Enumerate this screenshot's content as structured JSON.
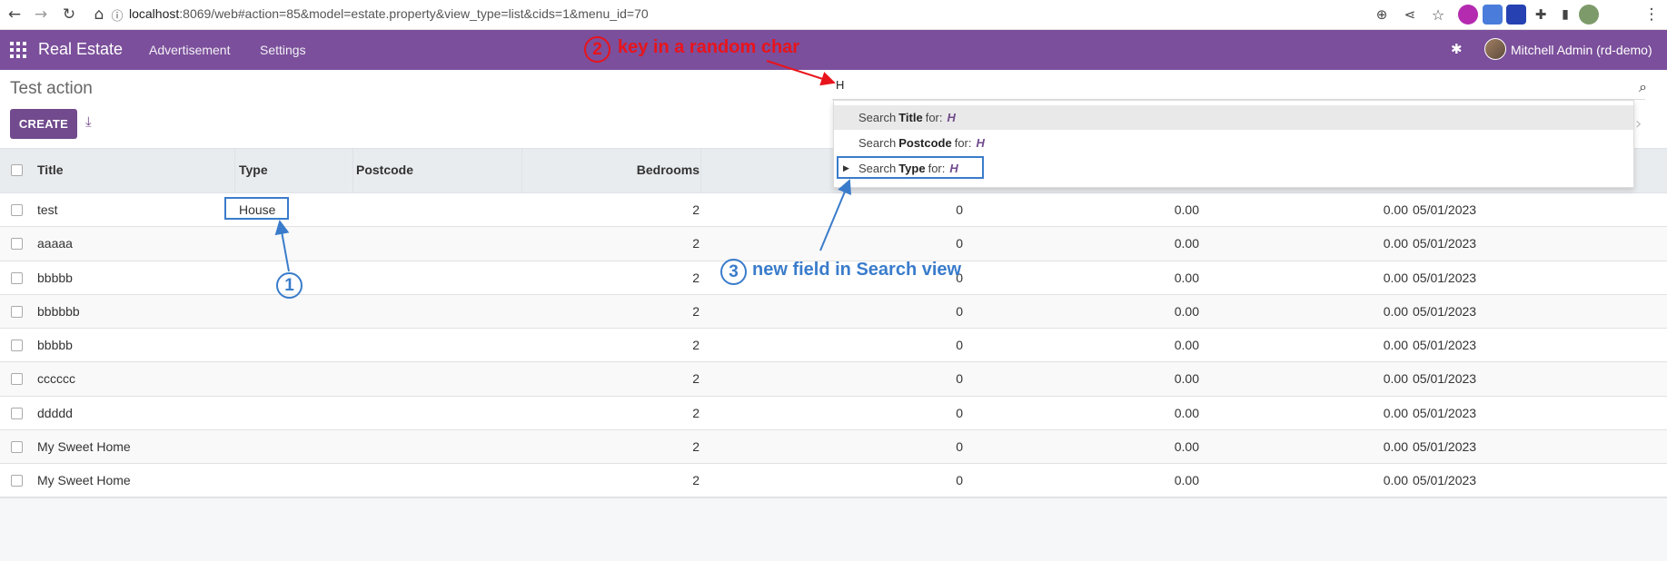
{
  "browser": {
    "url_host": "localhost",
    "url_rest": ":8069/web#action=85&model=estate.property&view_type=list&cids=1&menu_id=70"
  },
  "navbar": {
    "brand": "Real Estate",
    "menu": [
      "Advertisement",
      "Settings"
    ],
    "user": "Mitchell Admin (rd-demo)"
  },
  "control": {
    "title": "Test action",
    "create_label": "CREATE",
    "search_value": "H"
  },
  "table": {
    "columns": [
      "Title",
      "Type",
      "Postcode",
      "Bedrooms"
    ],
    "rows": [
      {
        "title": "test",
        "type": "House",
        "bedrooms": "2",
        "c1": "0",
        "c2": "0.00",
        "c3": "0.00",
        "date": "05/01/2023"
      },
      {
        "title": "aaaaa",
        "type": "",
        "bedrooms": "2",
        "c1": "0",
        "c2": "0.00",
        "c3": "0.00",
        "date": "05/01/2023"
      },
      {
        "title": "bbbbb",
        "type": "",
        "bedrooms": "2",
        "c1": "0",
        "c2": "0.00",
        "c3": "0.00",
        "date": "05/01/2023"
      },
      {
        "title": "bbbbbb",
        "type": "",
        "bedrooms": "2",
        "c1": "0",
        "c2": "0.00",
        "c3": "0.00",
        "date": "05/01/2023"
      },
      {
        "title": "bbbbb",
        "type": "",
        "bedrooms": "2",
        "c1": "0",
        "c2": "0.00",
        "c3": "0.00",
        "date": "05/01/2023"
      },
      {
        "title": "cccccc",
        "type": "",
        "bedrooms": "2",
        "c1": "0",
        "c2": "0.00",
        "c3": "0.00",
        "date": "05/01/2023"
      },
      {
        "title": "ddddd",
        "type": "",
        "bedrooms": "2",
        "c1": "0",
        "c2": "0.00",
        "c3": "0.00",
        "date": "05/01/2023"
      },
      {
        "title": "My Sweet Home",
        "type": "",
        "bedrooms": "2",
        "c1": "0",
        "c2": "0.00",
        "c3": "0.00",
        "date": "05/01/2023"
      },
      {
        "title": "My Sweet Home",
        "type": "",
        "bedrooms": "2",
        "c1": "0",
        "c2": "0.00",
        "c3": "0.00",
        "date": "05/01/2023"
      }
    ]
  },
  "autocomplete": [
    {
      "prefix": "Search",
      "field": "Title",
      "suffix": "for:",
      "value": "H"
    },
    {
      "prefix": "Search",
      "field": "Postcode",
      "suffix": "for:",
      "value": "H"
    },
    {
      "prefix": "Search",
      "field": "Type",
      "suffix": "for:",
      "value": "H"
    }
  ],
  "annotations": {
    "one": "1",
    "two": "2",
    "three": "3",
    "text_two": "key in a random char",
    "text_three": "new field in Search view"
  },
  "colors": {
    "navbar": "#7b4f9b",
    "primary": "#714b8d",
    "annotation_red": "#e8141c",
    "annotation_blue": "#3a7ccb"
  }
}
